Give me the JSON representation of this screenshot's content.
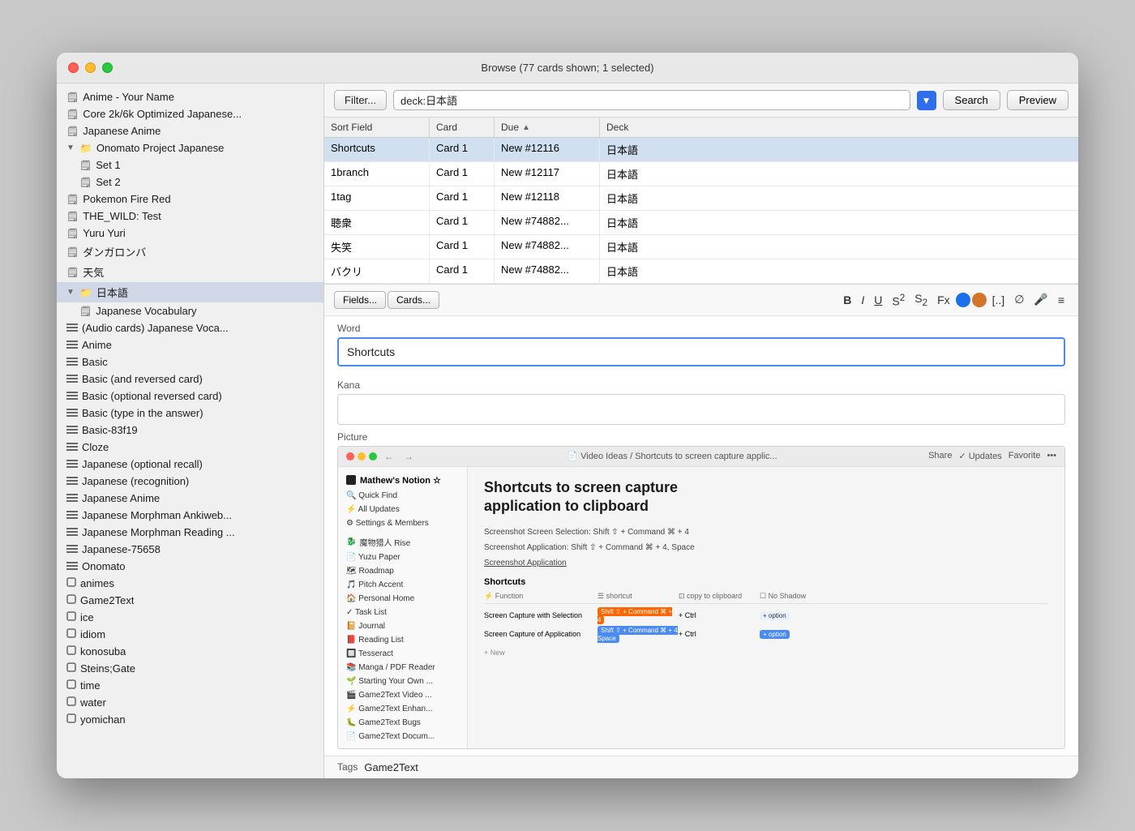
{
  "window": {
    "title": "Browse (77 cards shown; 1 selected)"
  },
  "toolbar": {
    "filter_label": "Filter...",
    "search_query": "deck:日本語",
    "search_label": "Search",
    "preview_label": "Preview"
  },
  "table": {
    "columns": [
      "Sort Field",
      "Card",
      "Due",
      "Deck"
    ],
    "rows": [
      {
        "sort_field": "Shortcuts",
        "card": "Card 1",
        "due": "New #12116",
        "deck": "日本語"
      },
      {
        "sort_field": "1branch",
        "card": "Card 1",
        "due": "New #12117",
        "deck": "日本語"
      },
      {
        "sort_field": "1tag",
        "card": "Card 1",
        "due": "New #12118",
        "deck": "日本語"
      },
      {
        "sort_field": "聴衆",
        "card": "Card 1",
        "due": "New #74882...",
        "deck": "日本語"
      },
      {
        "sort_field": "失笑",
        "card": "Card 1",
        "due": "New #74882...",
        "deck": "日本語"
      },
      {
        "sort_field": "バクリ",
        "card": "Card 1",
        "due": "New #74882...",
        "deck": "日本語"
      }
    ]
  },
  "editor": {
    "fields_label": "Fields...",
    "cards_label": "Cards...",
    "formatting_buttons": [
      "B",
      "I",
      "U",
      "S²",
      "S₂",
      "Fx",
      "◉",
      "◍",
      "[..]",
      "∅",
      "🎤",
      "≡"
    ],
    "word_label": "Word",
    "word_value": "Shortcuts",
    "kana_label": "Kana",
    "kana_value": "",
    "picture_label": "Picture",
    "tags_label": "Tags",
    "tags_value": "Game2Text"
  },
  "mini_browser": {
    "url": "Video Ideas / Shortcuts to screen capture applic...",
    "actions": [
      "Share",
      "✓ Updates",
      "Favorite",
      "•••"
    ],
    "sidebar_header": "Mathew's Notion",
    "sidebar_items": [
      "Quick Find",
      "All Updates",
      "Settings & Members"
    ],
    "sidebar_pages": [
      "魔物猎人 Rise",
      "Yuzu Paper",
      "Roadmap",
      "Pitch Accent",
      "Personal Home",
      "Task List",
      "Journal",
      "Reading List",
      "Tesseract",
      "Manga / PDF Reader",
      "Starting Your Own...",
      "Game2Text Video...",
      "Game2Text Enhan...",
      "Game2Text Bugs",
      "Game2Text Docum..."
    ],
    "title": "Shortcuts to screen capture application to clipboard",
    "text1": "Screenshot Screen Selection: Shift ⇧ + Command ⌘ + 4",
    "text2": "Screenshot Application: Shift ⇧ + Command ⌘ + 4, Space",
    "text3": "Screenshot Application",
    "shortcuts_label": "Shortcuts",
    "table_headers": [
      "⚡ Function",
      "☰ shortcut",
      "⊡ copy to clipboard",
      "☐ No Shadow"
    ],
    "table_rows": [
      {
        "function": "Screen Capture with Selection",
        "shortcut_badge": "Shift ⇧ + Command ⌘ + 4",
        "shortcut_color": "orange",
        "copy": "+ Ctrl",
        "shadow_badge": "+ option",
        "shadow_color": "light"
      },
      {
        "function": "Screen Capture of Application",
        "shortcut_badge": "Shift ⇧ + Command ⌘ + 4 Space",
        "shortcut_color": "blue",
        "copy": "+ Ctrl",
        "shadow_badge": "+ option",
        "shadow_color": "blue"
      }
    ]
  },
  "sidebar": {
    "items": [
      {
        "label": "Anime - Your Name",
        "indent": 0,
        "icon": "📄",
        "expanded": false
      },
      {
        "label": "Core 2k/6k Optimized Japanese...",
        "indent": 0,
        "icon": "📄",
        "expanded": false
      },
      {
        "label": "Japanese Anime",
        "indent": 0,
        "icon": "📄",
        "expanded": false
      },
      {
        "label": "Onomato Project Japanese",
        "indent": 0,
        "icon": "📁",
        "expanded": true,
        "has_arrow": true
      },
      {
        "label": "Set 1",
        "indent": 1,
        "icon": "📄",
        "expanded": false
      },
      {
        "label": "Set 2",
        "indent": 1,
        "icon": "📄",
        "expanded": false
      },
      {
        "label": "Pokemon Fire Red",
        "indent": 0,
        "icon": "📄",
        "expanded": false
      },
      {
        "label": "THE_WILD: Test",
        "indent": 0,
        "icon": "📄",
        "expanded": false
      },
      {
        "label": "Yuru Yuri",
        "indent": 0,
        "icon": "📄",
        "expanded": false
      },
      {
        "label": "ダンガロンバ",
        "indent": 0,
        "icon": "📄",
        "expanded": false
      },
      {
        "label": "天気",
        "indent": 0,
        "icon": "📄",
        "expanded": false
      },
      {
        "label": "日本語",
        "indent": 0,
        "icon": "📁",
        "expanded": true,
        "has_arrow": true,
        "selected": true
      },
      {
        "label": "Japanese Vocabulary",
        "indent": 1,
        "icon": "📄",
        "expanded": false
      },
      {
        "label": "(Audio cards) Japanese Voca...",
        "indent": 0,
        "icon": "≡",
        "expanded": false
      },
      {
        "label": "Anime",
        "indent": 0,
        "icon": "≡",
        "expanded": false
      },
      {
        "label": "Basic",
        "indent": 0,
        "icon": "≡",
        "expanded": false
      },
      {
        "label": "Basic (and reversed card)",
        "indent": 0,
        "icon": "≡",
        "expanded": false
      },
      {
        "label": "Basic (optional reversed card)",
        "indent": 0,
        "icon": "≡",
        "expanded": false
      },
      {
        "label": "Basic (type in the answer)",
        "indent": 0,
        "icon": "≡",
        "expanded": false
      },
      {
        "label": "Basic-83f19",
        "indent": 0,
        "icon": "≡",
        "expanded": false
      },
      {
        "label": "Cloze",
        "indent": 0,
        "icon": "≡",
        "expanded": false
      },
      {
        "label": "Japanese (optional recall)",
        "indent": 0,
        "icon": "≡",
        "expanded": false
      },
      {
        "label": "Japanese (recognition)",
        "indent": 0,
        "icon": "≡",
        "expanded": false
      },
      {
        "label": "Japanese Anime",
        "indent": 0,
        "icon": "≡",
        "expanded": false
      },
      {
        "label": "Japanese Morphman Ankiweb...",
        "indent": 0,
        "icon": "≡",
        "expanded": false
      },
      {
        "label": "Japanese Morphman Reading ...",
        "indent": 0,
        "icon": "≡",
        "expanded": false
      },
      {
        "label": "Japanese-75658",
        "indent": 0,
        "icon": "≡",
        "expanded": false
      },
      {
        "label": "Onomato",
        "indent": 0,
        "icon": "≡",
        "expanded": false
      },
      {
        "label": "animes",
        "indent": 0,
        "icon": "□",
        "expanded": false
      },
      {
        "label": "Game2Text",
        "indent": 0,
        "icon": "□",
        "expanded": false
      },
      {
        "label": "ice",
        "indent": 0,
        "icon": "□",
        "expanded": false
      },
      {
        "label": "idiom",
        "indent": 0,
        "icon": "□",
        "expanded": false
      },
      {
        "label": "konosuba",
        "indent": 0,
        "icon": "□",
        "expanded": false
      },
      {
        "label": "Steins;Gate",
        "indent": 0,
        "icon": "□",
        "expanded": false
      },
      {
        "label": "time",
        "indent": 0,
        "icon": "□",
        "expanded": false
      },
      {
        "label": "water",
        "indent": 0,
        "icon": "□",
        "expanded": false
      },
      {
        "label": "yomichan",
        "indent": 0,
        "icon": "□",
        "expanded": false
      }
    ]
  }
}
